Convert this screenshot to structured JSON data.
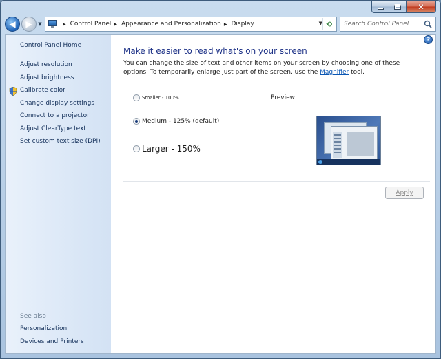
{
  "window": {
    "caption_icons": [
      "minimize-icon",
      "maximize-icon",
      "close-icon"
    ]
  },
  "nav": {
    "back_icon": "arrow-left-icon",
    "forward_icon": "arrow-right-icon",
    "breadcrumbs": [
      "Control Panel",
      "Appearance and Personalization",
      "Display"
    ],
    "search_placeholder": "Search Control Panel"
  },
  "sidebar": {
    "home": "Control Panel Home",
    "links": [
      "Adjust resolution",
      "Adjust brightness",
      "Calibrate color",
      "Change display settings",
      "Connect to a projector",
      "Adjust ClearType text",
      "Set custom text size (DPI)"
    ],
    "see_also_label": "See also",
    "see_also": [
      "Personalization",
      "Devices and Printers"
    ]
  },
  "main": {
    "heading": "Make it easier to read what's on your screen",
    "desc_part1": "You can change the size of text and other items on your screen by choosing one of these options. To temporarily enlarge just part of the screen, use the ",
    "desc_link": "Magnifier",
    "desc_part2": " tool.",
    "options": [
      {
        "label": "Smaller - 100%",
        "checked": false
      },
      {
        "label": "Medium - 125% (default)",
        "checked": true
      },
      {
        "label": "Larger - 150%",
        "checked": false
      }
    ],
    "preview_label": "Preview",
    "apply_label": "Apply",
    "apply_enabled": false
  },
  "colors": {
    "heading": "#1e3287",
    "link": "#15315b",
    "accent": "#0b57b4"
  }
}
